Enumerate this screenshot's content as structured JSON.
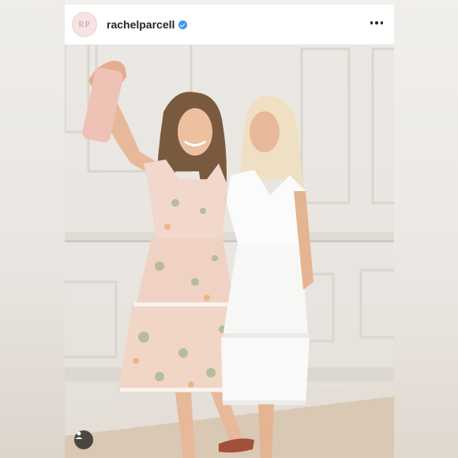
{
  "post": {
    "avatar_initials": "RP",
    "username": "rachelparcell",
    "verified": true,
    "more_icon": "more-horizontal-icon",
    "tag_icon": "user-tag-icon"
  },
  "colors": {
    "verified_badge": "#3897f0",
    "username_text": "#262626",
    "avatar_bg": "#f7e3e4"
  }
}
